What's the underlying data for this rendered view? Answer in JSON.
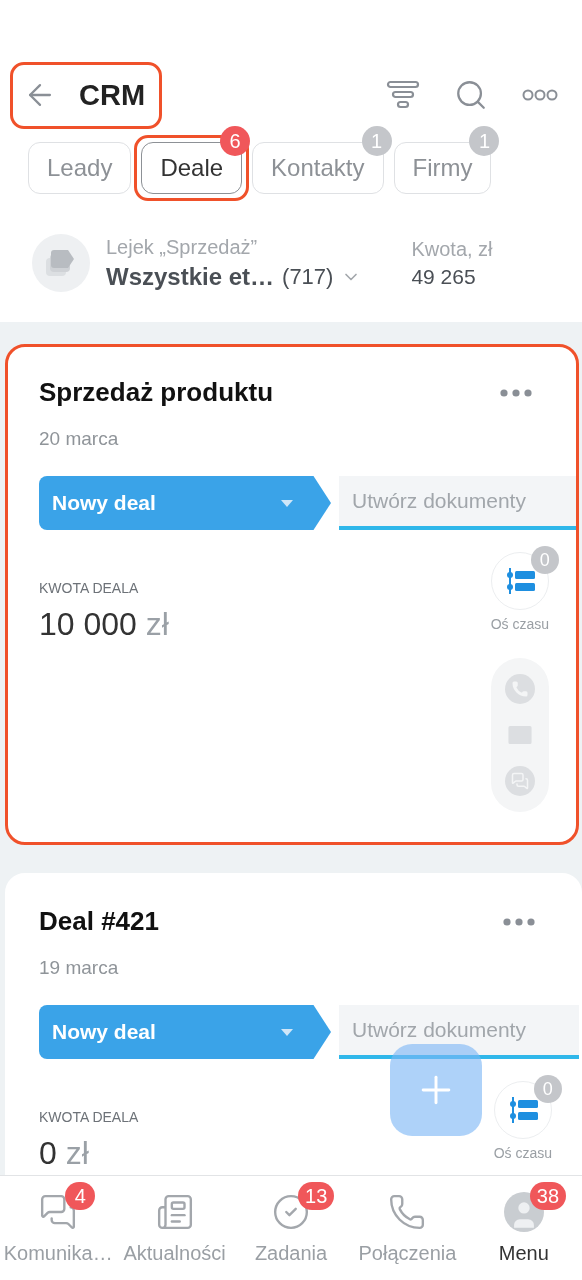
{
  "header": {
    "title": "CRM",
    "highlighted": true
  },
  "tabs": [
    {
      "label": "Leady",
      "selected": false,
      "highlighted": false
    },
    {
      "label": "Deale",
      "selected": true,
      "highlighted": true,
      "badge": "6",
      "color": "#f0575a"
    },
    {
      "label": "Kontakty",
      "selected": false,
      "highlighted": false,
      "badge": "1",
      "color": "#c4c6ca"
    },
    {
      "label": "Firmy",
      "selected": false,
      "highlighted": false,
      "badge": "1",
      "color": "#c4c6ca"
    }
  ],
  "pipeline": {
    "funnel": "Lejek „Sprzedaż”",
    "stage": "Wszystkie et…",
    "count": "(717)",
    "amount_label": "Kwota, zł",
    "amount": "49 265"
  },
  "deals": [
    {
      "title": "Sprzedaż produktu",
      "date": "20 marca",
      "stage": "Nowy deal",
      "next_stage": "Utwórz dokumenty",
      "amount_label": "KWOTA DEALA",
      "amount": "10 000",
      "currency": "zł",
      "timeline_count": "0",
      "timeline_label": "Oś czasu",
      "contact_actions": true,
      "highlighted": true
    },
    {
      "title": "Deal #421",
      "date": "19 marca",
      "stage": "Nowy deal",
      "next_stage": "Utwórz dokumenty",
      "amount_label": "KWOTA DEALA",
      "amount": "0",
      "currency": "zł",
      "timeline_count": "0",
      "timeline_label": "Oś czasu",
      "highlighted": false
    }
  ],
  "nav": [
    {
      "kind": "chat",
      "label": "Komunika…",
      "badge": "4",
      "selected": false
    },
    {
      "kind": "feed",
      "label": "Aktualności",
      "selected": false
    },
    {
      "kind": "tasks",
      "label": "Zadania",
      "badge": "13",
      "selected": false
    },
    {
      "kind": "calls",
      "label": "Połączenia",
      "selected": false
    },
    {
      "kind": "avatar",
      "label": "Menu",
      "badge": "38",
      "selected": true
    }
  ]
}
